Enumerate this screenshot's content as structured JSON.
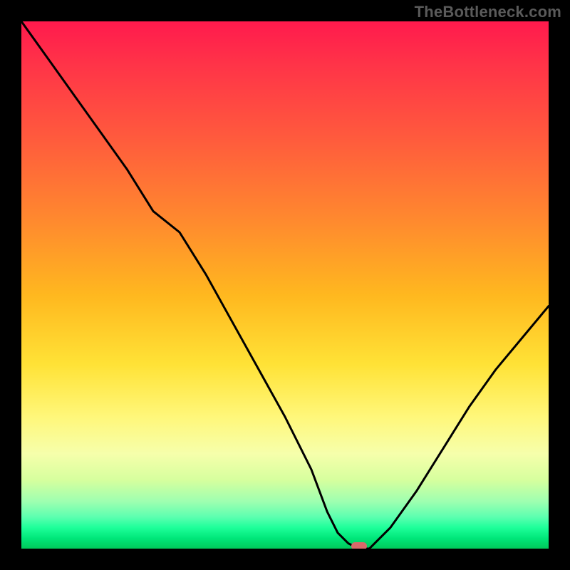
{
  "watermark": "TheBottleneck.com",
  "chart_data": {
    "type": "line",
    "title": "",
    "xlabel": "",
    "ylabel": "",
    "xlim": [
      0,
      100
    ],
    "ylim": [
      0,
      100
    ],
    "grid": false,
    "legend": false,
    "series": [
      {
        "name": "bottleneck-curve",
        "x": [
          0,
          5,
          10,
          15,
          20,
          25,
          30,
          35,
          40,
          45,
          50,
          55,
          58,
          60,
          62,
          64,
          66,
          70,
          75,
          80,
          85,
          90,
          95,
          100
        ],
        "y": [
          100,
          93,
          86,
          79,
          72,
          64,
          60,
          52,
          43,
          34,
          25,
          15,
          7,
          3,
          1,
          0,
          0,
          4,
          11,
          19,
          27,
          34,
          40,
          46
        ]
      }
    ],
    "marker": {
      "x": 64,
      "y": 0,
      "name": "optimal-point"
    },
    "background_gradient": {
      "stops": [
        {
          "pos": 0,
          "color": "#ff1a4d"
        },
        {
          "pos": 50,
          "color": "#ffd23a"
        },
        {
          "pos": 82,
          "color": "#f6ffab"
        },
        {
          "pos": 100,
          "color": "#00c95a"
        }
      ]
    }
  }
}
